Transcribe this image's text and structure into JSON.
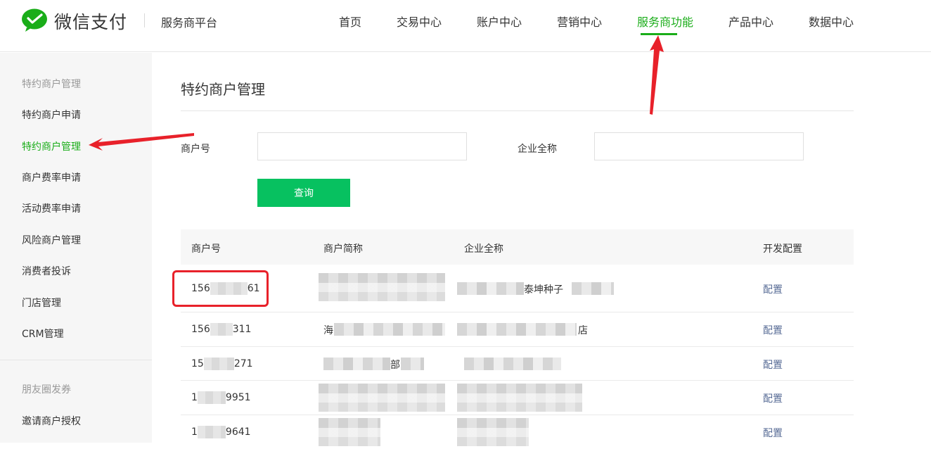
{
  "header": {
    "brand": "微信支付",
    "platform": "服务商平台",
    "nav": [
      {
        "label": "首页"
      },
      {
        "label": "交易中心"
      },
      {
        "label": "账户中心"
      },
      {
        "label": "营销中心"
      },
      {
        "label": "服务商功能",
        "active": true
      },
      {
        "label": "产品中心"
      },
      {
        "label": "数据中心"
      }
    ]
  },
  "sidebar": {
    "groups": [
      {
        "title": "特约商户管理",
        "items": [
          {
            "label": "特约商户申请"
          },
          {
            "label": "特约商户管理",
            "active": true
          },
          {
            "label": "商户费率申请"
          },
          {
            "label": "活动费率申请"
          },
          {
            "label": "风险商户管理"
          },
          {
            "label": "消费者投诉"
          },
          {
            "label": "门店管理"
          },
          {
            "label": "CRM管理"
          }
        ]
      },
      {
        "title": "朋友圈发券",
        "items": [
          {
            "label": "邀请商户授权"
          }
        ]
      }
    ]
  },
  "main": {
    "title": "特约商户管理",
    "form": {
      "merchant_no_label": "商户号",
      "merchant_no_value": "",
      "company_label": "企业全称",
      "company_value": "",
      "query_button": "查询"
    },
    "table": {
      "columns": [
        "商户号",
        "商户简称",
        "企业全称",
        "开发配置"
      ],
      "rows": [
        {
          "id_prefix": "156",
          "id_suffix": "61",
          "short_name": "",
          "company": "泰坤种子",
          "action": "配置"
        },
        {
          "id_prefix": "156",
          "id_suffix": "311",
          "short_name": "海",
          "company": "店",
          "action": "配置"
        },
        {
          "id_prefix": "15",
          "id_suffix": "271",
          "short_name": "部",
          "company": "",
          "action": "配置"
        },
        {
          "id_prefix": "1",
          "id_suffix": "9951",
          "short_name": "",
          "company": "",
          "action": "配置"
        },
        {
          "id_prefix": "1",
          "id_suffix": "9641",
          "short_name": "",
          "company": "",
          "action": "配置"
        }
      ]
    }
  },
  "colors": {
    "accent": "#1aad19",
    "button": "#07c160",
    "link": "#576b95",
    "annotation": "#e8212a"
  },
  "icons": {
    "logo": "wechat-pay-logo-icon"
  }
}
